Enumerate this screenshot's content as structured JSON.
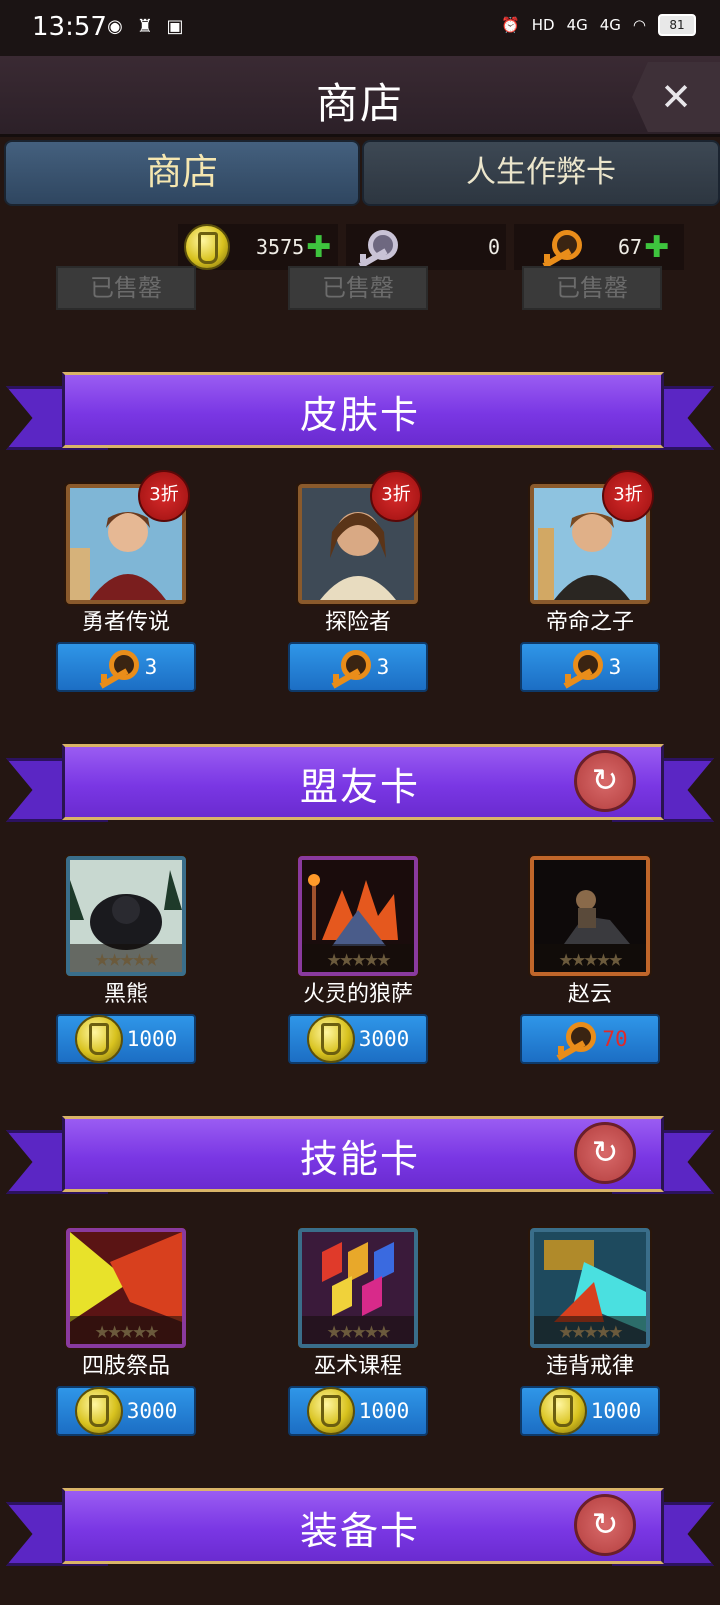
{
  "status": {
    "time": "13:57",
    "network1": "HD",
    "network2": "4G",
    "network3": "4G",
    "battery": "81"
  },
  "header": {
    "title": "商店",
    "close_label": "✕"
  },
  "tabs": [
    {
      "label": "商店",
      "active": true
    },
    {
      "label": "人生作弊卡",
      "active": false
    }
  ],
  "currencies": [
    {
      "icon": "gold-coin-icon",
      "value": "3575",
      "add": "✚"
    },
    {
      "icon": "silver-key-icon",
      "value": "0"
    },
    {
      "icon": "orange-key-icon",
      "value": "67",
      "add": "✚"
    }
  ],
  "soldout_label": "已售罄",
  "sections": [
    {
      "title": "皮肤卡",
      "refresh": false,
      "items": [
        {
          "name": "勇者传说",
          "badge": "3折",
          "currency": "key",
          "price": "3"
        },
        {
          "name": "探险者",
          "badge": "3折",
          "currency": "key",
          "price": "3"
        },
        {
          "name": "帝命之子",
          "badge": "3折",
          "currency": "key",
          "price": "3"
        }
      ]
    },
    {
      "title": "盟友卡",
      "refresh": true,
      "items": [
        {
          "name": "黑熊",
          "currency": "coin",
          "price": "1000"
        },
        {
          "name": "火灵的狼萨",
          "currency": "coin",
          "price": "3000"
        },
        {
          "name": "赵云",
          "currency": "key",
          "price": "70",
          "price_color": "#e02a2a"
        }
      ]
    },
    {
      "title": "技能卡",
      "refresh": true,
      "items": [
        {
          "name": "四肢祭品",
          "currency": "coin",
          "price": "3000"
        },
        {
          "name": "巫术课程",
          "currency": "coin",
          "price": "1000"
        },
        {
          "name": "违背戒律",
          "currency": "coin",
          "price": "1000"
        }
      ]
    },
    {
      "title": "装备卡",
      "refresh": true,
      "items": []
    }
  ],
  "stars": "★★★★★",
  "refresh_icon": "↻",
  "colors": {
    "accent_purple": "#7a37e4",
    "price_blue": "#1c6ec4",
    "plus_green": "#3ec43e"
  }
}
